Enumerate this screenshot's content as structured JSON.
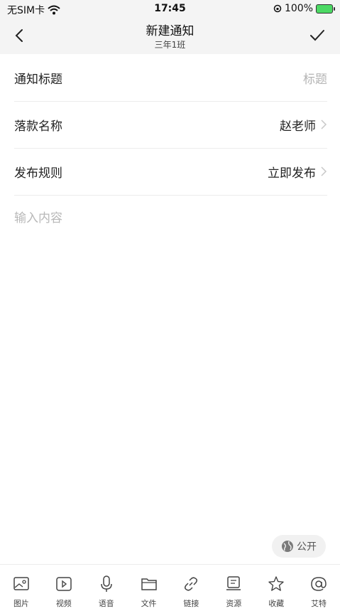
{
  "status": {
    "carrier": "无SIM卡",
    "time": "17:45",
    "battery": "100%"
  },
  "nav": {
    "title": "新建通知",
    "subtitle": "三年1班"
  },
  "form": {
    "title_label": "通知标题",
    "title_placeholder": "标题",
    "signature_label": "落款名称",
    "signature_value": "赵老师",
    "rule_label": "发布规则",
    "rule_value": "立即发布",
    "content_placeholder": "输入内容"
  },
  "public_label": "公开",
  "toolbar": [
    {
      "label": "图片",
      "icon": "image-icon"
    },
    {
      "label": "视频",
      "icon": "video-icon"
    },
    {
      "label": "语音",
      "icon": "microphone-icon"
    },
    {
      "label": "文件",
      "icon": "folder-icon"
    },
    {
      "label": "链接",
      "icon": "link-icon"
    },
    {
      "label": "资源",
      "icon": "resource-icon"
    },
    {
      "label": "收藏",
      "icon": "star-icon"
    },
    {
      "label": "艾特",
      "icon": "at-icon"
    }
  ]
}
